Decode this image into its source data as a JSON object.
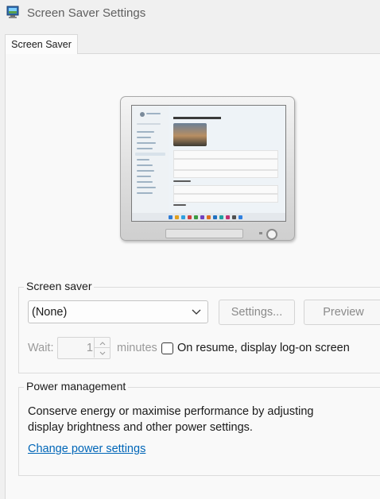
{
  "window": {
    "title": "Screen Saver Settings",
    "icon": "screen-saver-app-icon"
  },
  "tabs": [
    {
      "label": "Screen Saver",
      "selected": true
    }
  ],
  "screen_saver": {
    "group_label": "Screen saver",
    "selected": "(None)",
    "settings_button": "Settings...",
    "preview_button": "Preview",
    "wait_label": "Wait:",
    "wait_value": "1",
    "minutes_label": "minutes",
    "resume_checkbox_label": "On resume, display log-on screen",
    "resume_checked": false
  },
  "power_management": {
    "group_label": "Power management",
    "description_line1": "Conserve energy or maximise performance by adjusting",
    "description_line2": "display brightness and other power settings.",
    "link": "Change power settings"
  },
  "colors": {
    "link": "#0066b8",
    "disabled_text": "#8a8a8a",
    "panel": "#f9f9f9"
  }
}
